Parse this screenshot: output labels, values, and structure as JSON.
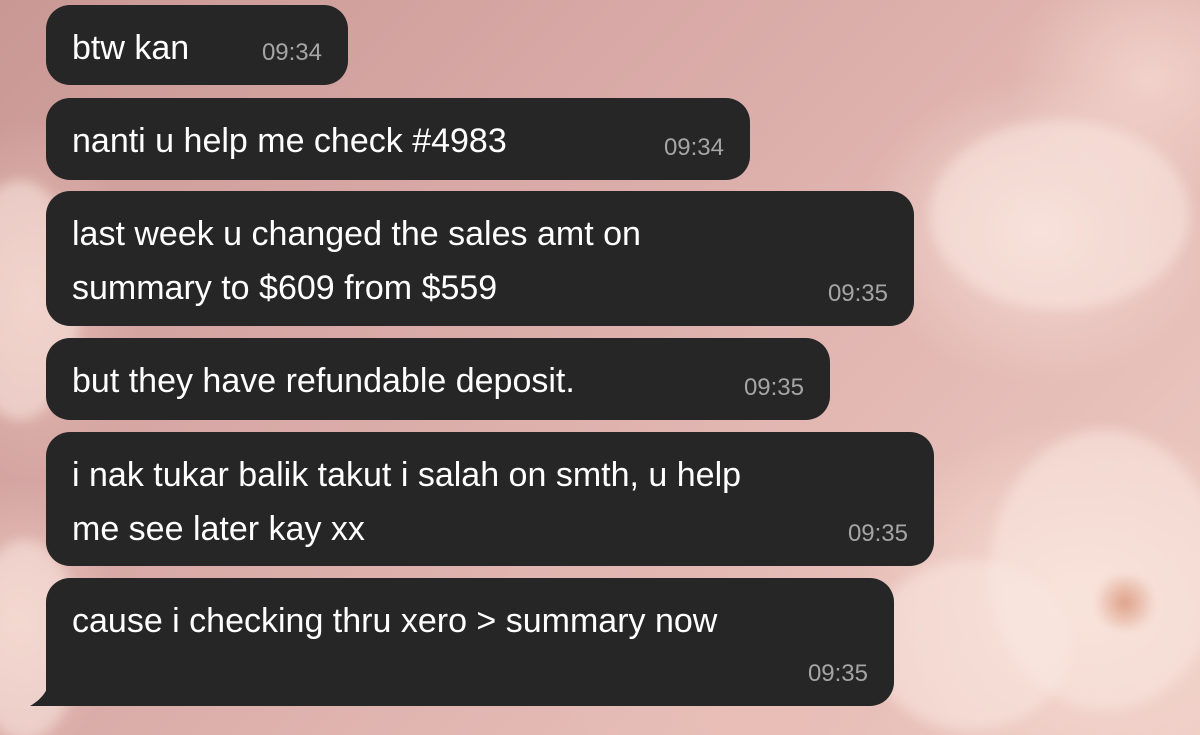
{
  "colors": {
    "bubble_background": "#262626",
    "message_text": "#ffffff",
    "timestamp_text": "#a5a5a5",
    "wallpaper_base": "#d9aaa6"
  },
  "messages": [
    {
      "text": "btw kan",
      "time": "09:34"
    },
    {
      "text": "nanti u help me check #4983",
      "time": "09:34"
    },
    {
      "text": "last week u changed the sales amt on\nsummary to $609 from $559",
      "time": "09:35"
    },
    {
      "text": "but they have refundable deposit.",
      "time": "09:35"
    },
    {
      "text": "i nak tukar balik takut i salah on smth, u help\nme see later kay xx",
      "time": "09:35"
    },
    {
      "text": "cause i checking thru xero > summary now",
      "time": "09:35"
    }
  ]
}
